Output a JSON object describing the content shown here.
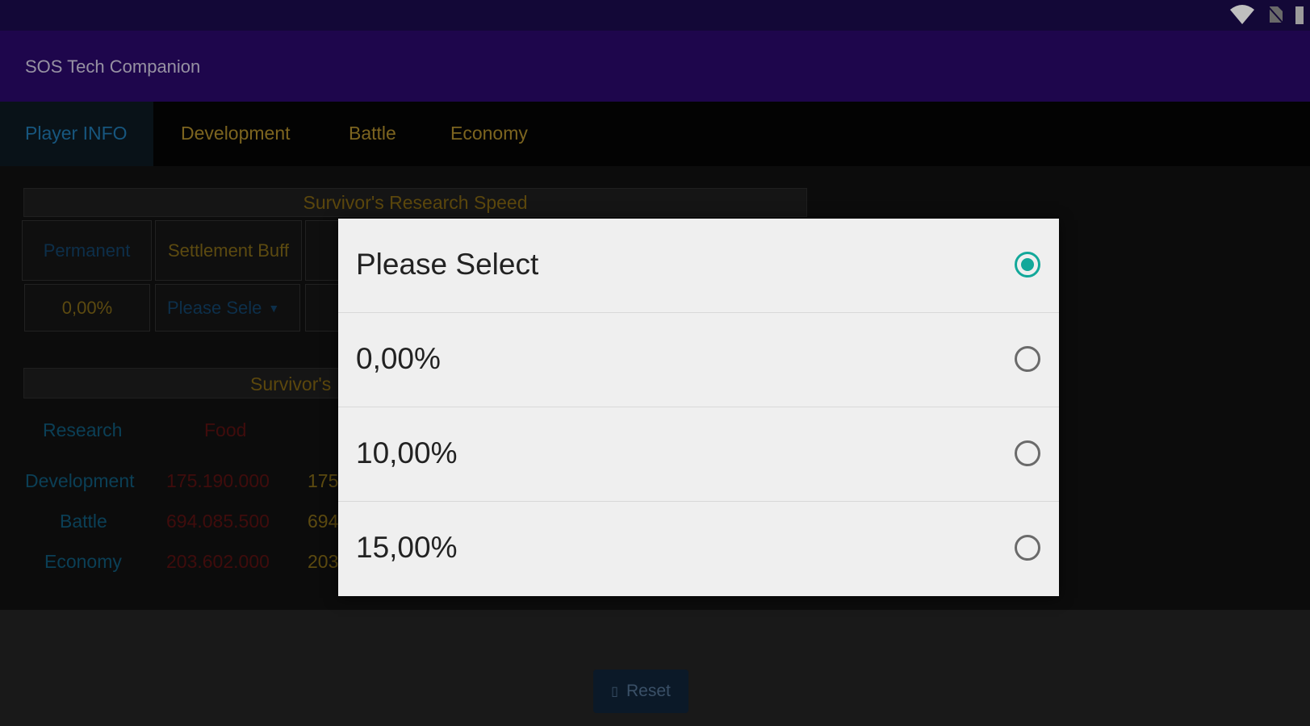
{
  "app": {
    "title": "SOS Tech Companion"
  },
  "tabs": [
    {
      "label": "Player INFO",
      "active": true
    },
    {
      "label": "Development"
    },
    {
      "label": "Battle"
    },
    {
      "label": "Economy"
    }
  ],
  "research_speed": {
    "header": "Survivor's Research Speed",
    "col_permanent": "Permanent",
    "col_settlement": "Settlement Buff",
    "permanent_value": "0,00%",
    "settlement_value": "Please Sele"
  },
  "costs": {
    "header_partial": "Survivor's",
    "col_research": "Research",
    "col_food": "Food",
    "rows": [
      {
        "label": "Development",
        "food": "175.190.000",
        "next": "175"
      },
      {
        "label": "Battle",
        "food": "694.085.500",
        "next": "694"
      },
      {
        "label": "Economy",
        "food": "203.602.000",
        "next": "203"
      }
    ]
  },
  "reset_label": "Reset",
  "dialog": {
    "options": [
      {
        "label": "Please Select",
        "selected": true
      },
      {
        "label": "0,00%",
        "selected": false
      },
      {
        "label": "10,00%",
        "selected": false
      },
      {
        "label": "15,00%",
        "selected": false
      }
    ]
  },
  "colors": {
    "accent": "#13a89a",
    "appbar": "#290866",
    "statusbar": "#1a0b4a"
  },
  "icons": {
    "wifi": "wifi-icon",
    "signal": "no-sim-icon",
    "battery": "battery-icon",
    "reset": "reset-icon"
  }
}
